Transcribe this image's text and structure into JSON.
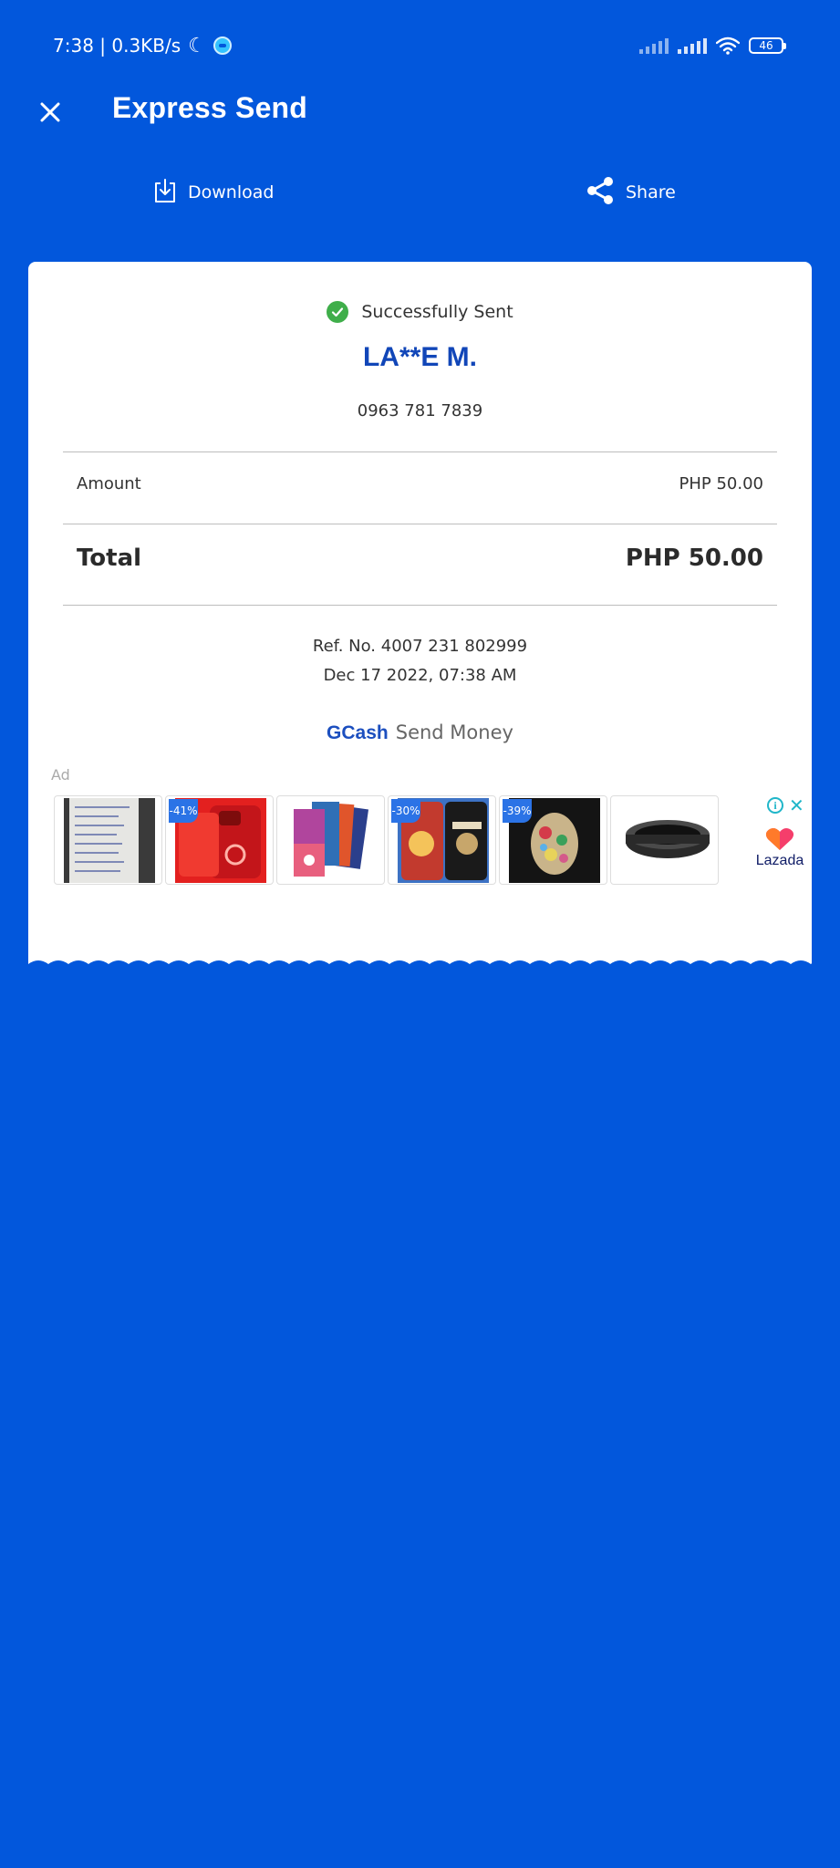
{
  "status_bar": {
    "time_and_speed": "7:38 | 0.3KB/s",
    "battery": "46"
  },
  "header": {
    "title": "Express Send"
  },
  "actions": {
    "download_label": "Download",
    "share_label": "Share"
  },
  "receipt": {
    "status": "Successfully Sent",
    "recipient": "LA**E M.",
    "phone": "0963 781 7839",
    "amount_label": "Amount",
    "amount_value": "PHP 50.00",
    "total_label": "Total",
    "total_value": "PHP 50.00",
    "ref_no": "Ref. No. 4007 231 802999",
    "datetime": "Dec 17 2022, 07:38 AM",
    "brand_name": "GCash",
    "brand_service": "Send Money"
  },
  "ad": {
    "label": "Ad",
    "products": [
      {
        "icon": "handwritten-list-phone-case",
        "discount": ""
      },
      {
        "icon": "red-phone-case",
        "discount": "-41%"
      },
      {
        "icon": "itunes-gift-cards",
        "discount": ""
      },
      {
        "icon": "anime-phone-case",
        "discount": "-30%"
      },
      {
        "icon": "bejeweled-phone-case",
        "discount": "-39%"
      },
      {
        "icon": "lens-hood",
        "discount": ""
      }
    ],
    "advertiser": "Lazada"
  },
  "colors": {
    "background": "#0257dc",
    "card": "#ffffff",
    "recipient_blue": "#1146b8",
    "success_green": "#3fae4a",
    "ad_accent": "#20b6c9"
  }
}
